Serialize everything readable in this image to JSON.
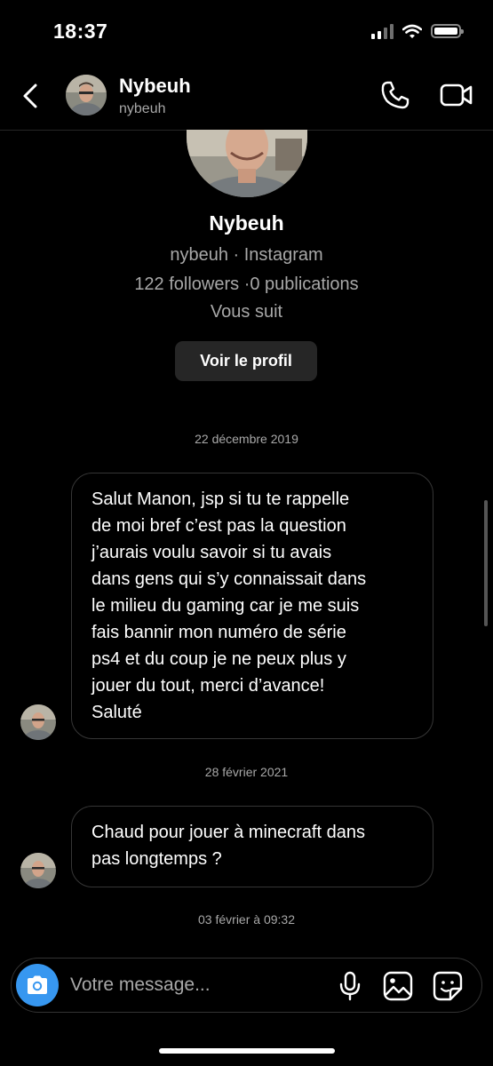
{
  "status_bar": {
    "time": "18:37"
  },
  "header": {
    "name": "Nybeuh",
    "username": "nybeuh",
    "back_icon": "chevron-left-icon",
    "call_icon": "phone-icon",
    "video_icon": "video-camera-icon"
  },
  "profile": {
    "name": "Nybeuh",
    "username_line": "nybeuh · Instagram",
    "stats_line": "122 followers ·0 publications",
    "follow_status": "Vous suit",
    "view_profile_label": "Voir le profil"
  },
  "conversation": {
    "date_1": "22 décembre 2019",
    "message_1": "Salut Manon, jsp si tu te rappelle\nde moi bref c’est pas la question\nj’aurais voulu savoir si tu avais\ndans gens qui s’y connaissait dans\nle milieu du gaming car je me suis\nfais bannir mon numéro de série\nps4 et du coup je ne peux plus y\njouer du tout, merci d’avance!\nSaluté",
    "date_2": "28 février 2021",
    "message_2": "Chaud pour jouer à minecraft dans\npas longtemps ?",
    "date_3": "03 février à 09:32"
  },
  "composer": {
    "placeholder": "Votre message...",
    "camera_icon": "camera-icon",
    "mic_icon": "microphone-icon",
    "gallery_icon": "image-icon",
    "sticker_icon": "sticker-icon"
  },
  "colors": {
    "background": "#000000",
    "accent": "#3797f0",
    "secondary_text": "#a8a8a8",
    "bubble_border": "#363636"
  }
}
